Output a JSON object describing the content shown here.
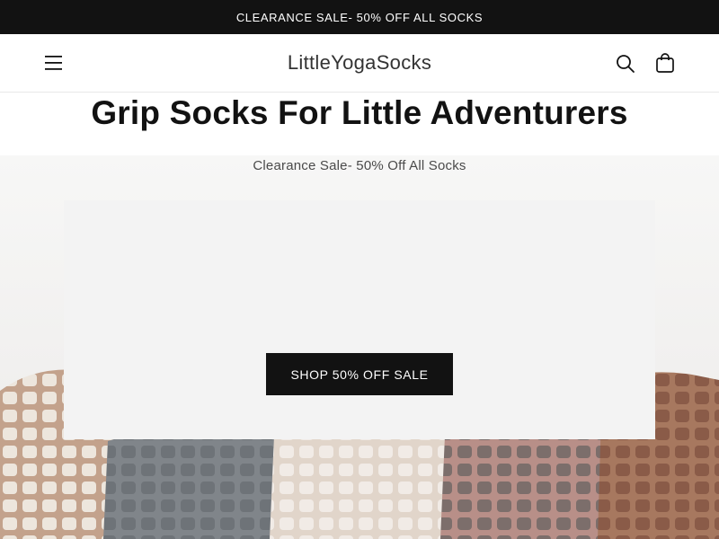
{
  "announcement": {
    "text": "CLEARANCE SALE- 50% OFF ALL SOCKS"
  },
  "header": {
    "logo": "LittleYogaSocks",
    "icons": {
      "menu": "hamburger-menu-icon",
      "search": "search-icon",
      "cart": "shopping-bag-icon"
    }
  },
  "hero": {
    "title": "Grip Socks For Little Adventurers",
    "subtitle": "Clearance Sale- 50% Off All Socks",
    "button_label": "SHOP 50% OFF SALE",
    "image": "row of baby grip socks with rubber dot soles",
    "sock_colors": [
      "#c7a690",
      "#7d8184",
      "#e4d9cf",
      "#bb958e",
      "#a67560"
    ]
  },
  "colors": {
    "bar": "#121212",
    "button": "#121212",
    "card": "#f3f3f3"
  }
}
